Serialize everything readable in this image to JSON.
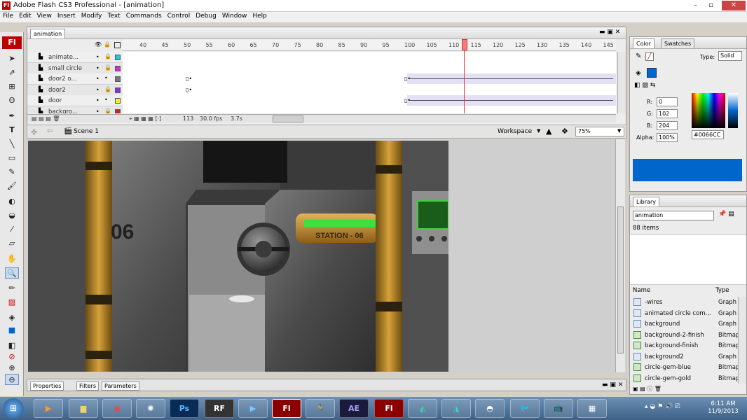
{
  "window": {
    "title": "Adobe Flash CS3 Professional - [animation]",
    "app_icon": "Fl"
  },
  "menu": [
    "File",
    "Edit",
    "View",
    "Insert",
    "Modify",
    "Text",
    "Commands",
    "Control",
    "Debug",
    "Window",
    "Help"
  ],
  "toolbox": {
    "logo": "Fl"
  },
  "timeline": {
    "tab": "animation",
    "frame_numbers": [
      "40",
      "45",
      "50",
      "55",
      "60",
      "65",
      "70",
      "75",
      "80",
      "85",
      "90",
      "95",
      "100",
      "105",
      "110",
      "115",
      "120",
      "125",
      "130",
      "135",
      "140",
      "145"
    ],
    "layers": [
      {
        "name": "animate...",
        "color": "#22cccc"
      },
      {
        "name": "small circle",
        "color": "#cc33cc"
      },
      {
        "name": "door2 o...",
        "color": "#777777"
      },
      {
        "name": "door2",
        "color": "#8833cc"
      },
      {
        "name": "door",
        "color": "#eeee33"
      },
      {
        "name": "backgro...",
        "color": "#cc2222"
      }
    ],
    "current_frame": "113",
    "fps": "30.0 fps",
    "time": "3.7s"
  },
  "scene": {
    "label": "Scene 1",
    "workspace": "Workspace",
    "zoom": "75%"
  },
  "stage": {
    "station_label": "STATION - 06",
    "door_number": "06"
  },
  "properties_tabs": [
    "Properties",
    "Filters",
    "Parameters"
  ],
  "color_panel": {
    "tabs": [
      "Color",
      "Swatches"
    ],
    "type_label": "Type:",
    "type_value": "Solid",
    "r_label": "R:",
    "r": "0",
    "g_label": "G:",
    "g": "102",
    "b_label": "B:",
    "b": "204",
    "alpha_label": "Alpha:",
    "alpha": "100%",
    "hex": "#0066CC",
    "fill_color": "#0066cc"
  },
  "library": {
    "tab": "Library",
    "source": "animation",
    "count": "88 items",
    "col_name": "Name",
    "col_type": "Type",
    "items": [
      {
        "name": "-wires",
        "type": "Graph"
      },
      {
        "name": "animated circle com...",
        "type": "Graph"
      },
      {
        "name": "background",
        "type": "Graph"
      },
      {
        "name": "background-2-finish",
        "type": "Bitmap"
      },
      {
        "name": "background-finish",
        "type": "Bitmap"
      },
      {
        "name": "background2",
        "type": "Graph"
      },
      {
        "name": "circle-gem-blue",
        "type": "Bitmap"
      },
      {
        "name": "circle-gem-gold",
        "type": "Bitmap"
      }
    ]
  },
  "taskbar": {
    "apps": [
      "Ps",
      "RF",
      "Fl",
      "AE",
      "Fl"
    ],
    "time": "6:11 AM",
    "date": "11/9/2013"
  }
}
